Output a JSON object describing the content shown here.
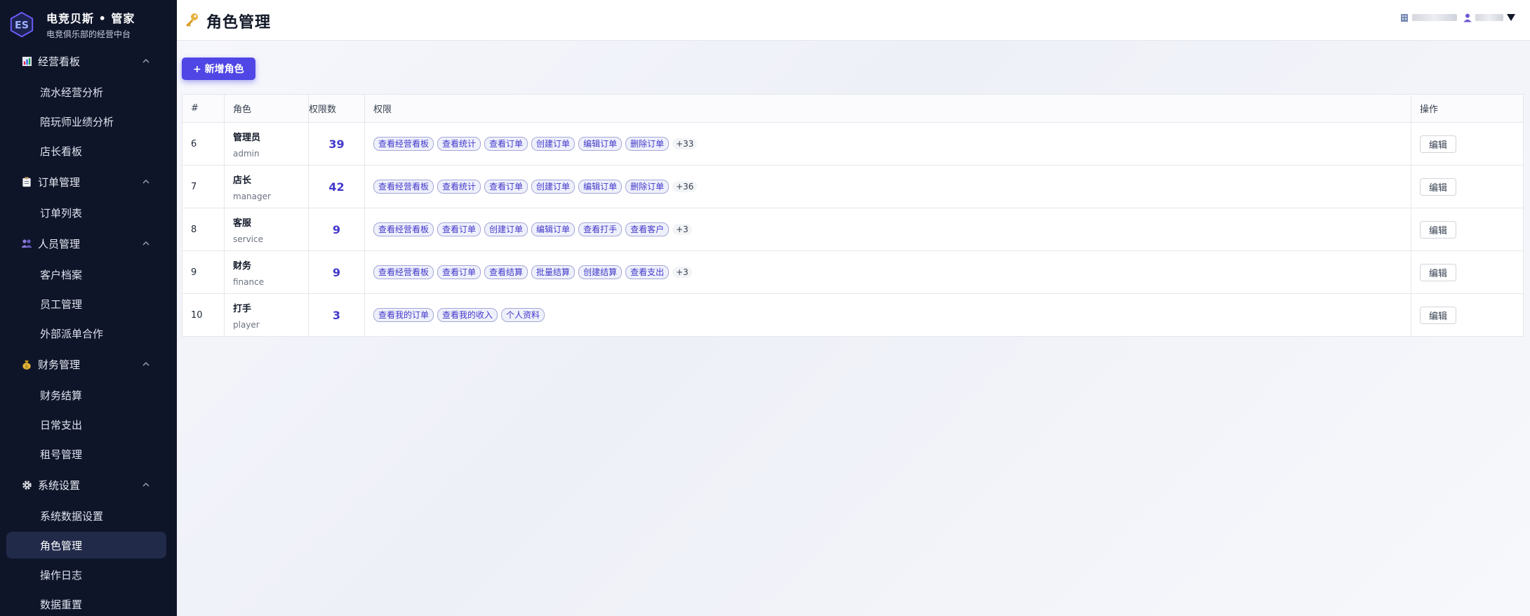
{
  "brand": {
    "title": "电竞贝斯 • 管家",
    "subtitle": "电竞俱乐部的经营中台"
  },
  "sidebar": {
    "groups": [
      {
        "label": "经营看板",
        "icon": "chart-icon",
        "items": [
          "流水经营分析",
          "陪玩师业绩分析",
          "店长看板"
        ]
      },
      {
        "label": "订单管理",
        "icon": "clipboard-icon",
        "items": [
          "订单列表"
        ]
      },
      {
        "label": "人员管理",
        "icon": "people-icon",
        "items": [
          "客户档案",
          "员工管理",
          "外部派单合作"
        ]
      },
      {
        "label": "财务管理",
        "icon": "money-bag-icon",
        "items": [
          "财务结算",
          "日常支出",
          "租号管理"
        ]
      },
      {
        "label": "系统设置",
        "icon": "gear-icon",
        "items": [
          "系统数据设置",
          "角色管理",
          "操作日志",
          "数据重置"
        ]
      }
    ],
    "active_item": "角色管理"
  },
  "header": {
    "title": "角色管理",
    "title_icon": "key-icon"
  },
  "toolbar": {
    "add_label": "+ 新增角色"
  },
  "table": {
    "columns": [
      "#",
      "角色",
      "权限数",
      "权限",
      "操作"
    ],
    "edit_label": "编辑",
    "rows": [
      {
        "id": "6",
        "name": "管理员",
        "key": "admin",
        "count": "39",
        "perms": [
          "查看经营看板",
          "查看统计",
          "查看订单",
          "创建订单",
          "编辑订单",
          "删除订单"
        ],
        "more": "+33"
      },
      {
        "id": "7",
        "name": "店长",
        "key": "manager",
        "count": "42",
        "perms": [
          "查看经营看板",
          "查看统计",
          "查看订单",
          "创建订单",
          "编辑订单",
          "删除订单"
        ],
        "more": "+36"
      },
      {
        "id": "8",
        "name": "客服",
        "key": "service",
        "count": "9",
        "perms": [
          "查看经营看板",
          "查看订单",
          "创建订单",
          "编辑订单",
          "查看打手",
          "查看客户"
        ],
        "more": "+3"
      },
      {
        "id": "9",
        "name": "财务",
        "key": "finance",
        "count": "9",
        "perms": [
          "查看经营看板",
          "查看订单",
          "查看结算",
          "批量结算",
          "创建结算",
          "查看支出"
        ],
        "more": "+3"
      },
      {
        "id": "10",
        "name": "打手",
        "key": "player",
        "count": "3",
        "perms": [
          "查看我的订单",
          "查看我的收入",
          "个人资料"
        ],
        "more": ""
      }
    ]
  },
  "colors": {
    "sidebar_bg": "#0f1529",
    "accent": "#4f46e5",
    "tag_text": "#4338ca"
  }
}
